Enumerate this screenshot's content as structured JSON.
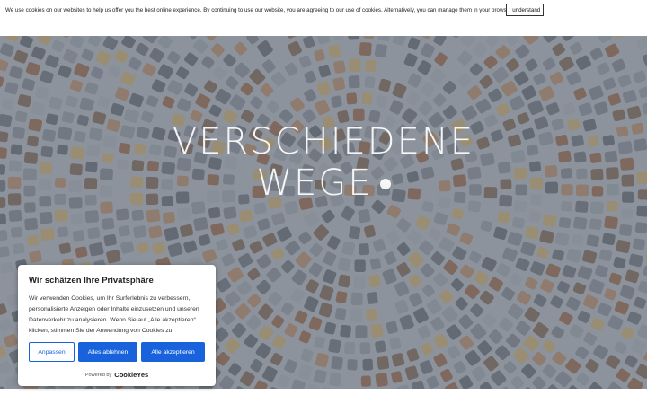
{
  "cookie_notice": {
    "text": "We use cookies on our websites to help us offer you the best online experience. By continuing to use our website, you are agreeing to our use of cookies. Alternatively, you can manage them in your browser settings.",
    "button_label": "I understand"
  },
  "hero": {
    "title_line1": "VERSCHIEDENE",
    "title_line2": "WEGE"
  },
  "consent": {
    "title": "Wir schätzen Ihre Privatsphäre",
    "body": "Wir verwenden Cookies, um Ihr Surferlebnis zu verbessern, personalisierte Anzeigen oder Inhalte einzusetzen und unseren Datenverkehr zu analysieren. Wenn Sie auf „Alle akzeptieren“ klicken, stimmen Sie der Anwendung von Cookies zu.",
    "customize_label": "Anpassen",
    "reject_label": "Alles ablehnen",
    "accept_label": "Alle akzeptieren",
    "powered_by": "Powered by",
    "brand": "CookieYes"
  },
  "colors": {
    "accent": "#1863dc",
    "text_dark": "#212121"
  }
}
